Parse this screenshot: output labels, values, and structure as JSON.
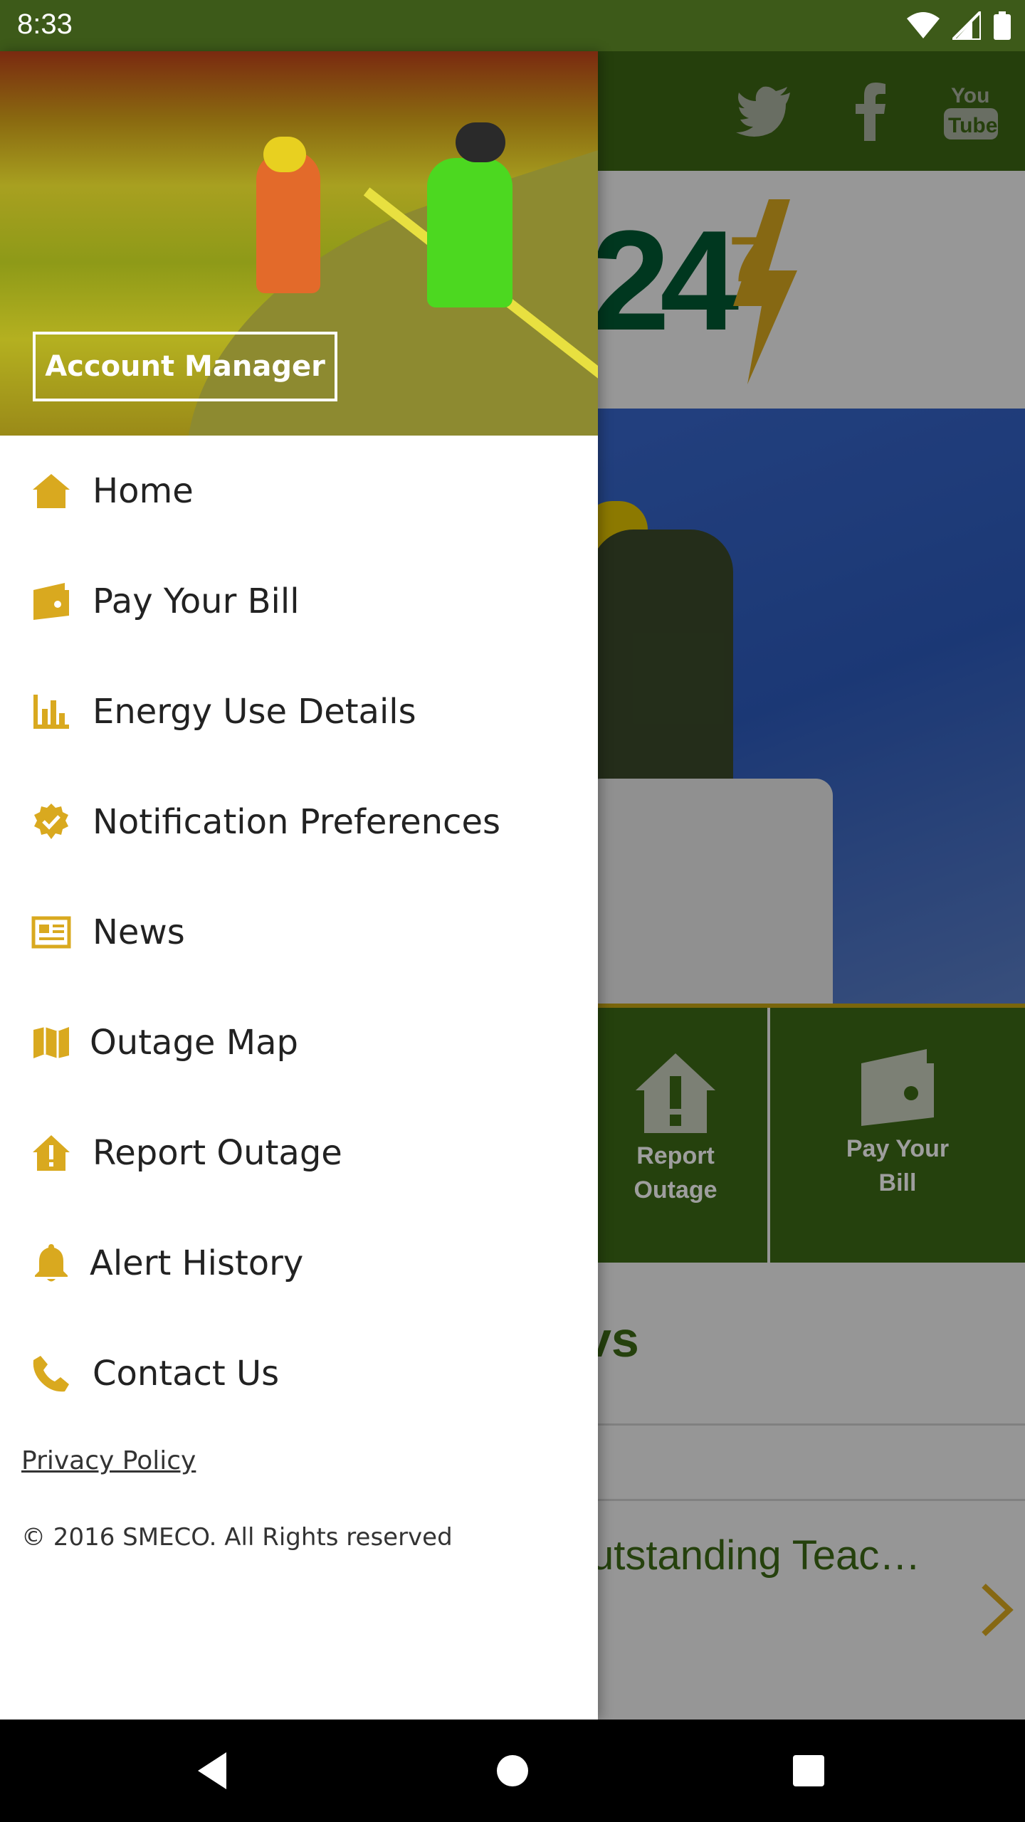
{
  "status_bar": {
    "time": "8:33"
  },
  "background": {
    "logo": "24",
    "logo_superscript": "7",
    "tiles": [
      {
        "label_line1": "Report",
        "label_line2": "Outage"
      },
      {
        "label_line1": "Pay Your",
        "label_line2": "Bill"
      }
    ],
    "news_heading_fragment": "vs",
    "news_item_fragment": "utstanding Teac…"
  },
  "drawer": {
    "account_button": "Account Manager",
    "menu": [
      {
        "label": "Home",
        "icon": "home-icon"
      },
      {
        "label": "Pay Your Bill",
        "icon": "wallet-icon"
      },
      {
        "label": "Energy Use Details",
        "icon": "bar-chart-icon"
      },
      {
        "label": "Notification Preferences",
        "icon": "verified-badge-icon"
      },
      {
        "label": "News",
        "icon": "newspaper-icon"
      },
      {
        "label": "Outage Map",
        "icon": "map-icon"
      },
      {
        "label": "Report Outage",
        "icon": "house-alert-icon"
      },
      {
        "label": "Alert History",
        "icon": "bell-icon"
      },
      {
        "label": "Contact Us",
        "icon": "phone-icon"
      }
    ],
    "privacy_link": "Privacy Policy",
    "copyright": "© 2016 SMECO. All Rights reserved"
  },
  "colors": {
    "accent": "#d9a91f",
    "brand_green": "#3d6614",
    "status_bar": "#3d5a19"
  }
}
